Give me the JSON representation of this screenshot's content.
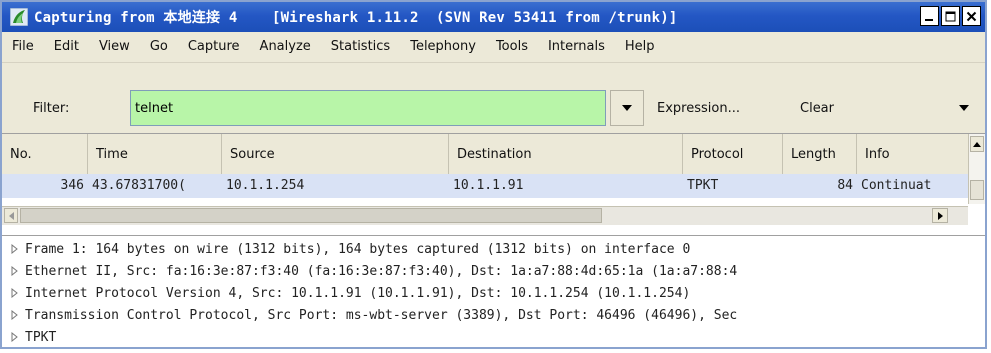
{
  "window": {
    "title": "Capturing from 本地连接 4    [Wireshark 1.11.2  (SVN Rev 53411 from /trunk)]",
    "controls": [
      "minimize",
      "maximize",
      "close"
    ],
    "title_color": "#2457c4"
  },
  "menu": {
    "items": [
      "File",
      "Edit",
      "View",
      "Go",
      "Capture",
      "Analyze",
      "Statistics",
      "Telephony",
      "Tools",
      "Internals",
      "Help"
    ]
  },
  "filter": {
    "label": "Filter:",
    "value": "telnet",
    "expression_label": "Expression...",
    "clear_label": "Clear",
    "valid_color": "#b8f5a8"
  },
  "packet_list": {
    "columns": [
      "No.",
      "Time",
      "Source",
      "Destination",
      "Protocol",
      "Length",
      "Info"
    ],
    "rows": [
      {
        "no": "346",
        "time": "43.67831700(",
        "source": "10.1.1.254",
        "destination": "10.1.1.91",
        "protocol": "TPKT",
        "length": "84",
        "info": "Continuat"
      }
    ],
    "selected_color": "#d9e2f5"
  },
  "details": {
    "items": [
      "Frame 1: 164 bytes on wire (1312 bits), 164 bytes captured (1312 bits) on interface 0",
      "Ethernet II, Src: fa:16:3e:87:f3:40 (fa:16:3e:87:f3:40), Dst: 1a:a7:88:4d:65:1a (1a:a7:88:4",
      "Internet Protocol Version 4, Src: 10.1.1.91 (10.1.1.91), Dst: 10.1.1.254 (10.1.1.254)",
      "Transmission Control Protocol, Src Port: ms-wbt-server (3389), Dst Port: 46496 (46496), Sec",
      "TPKT"
    ]
  }
}
